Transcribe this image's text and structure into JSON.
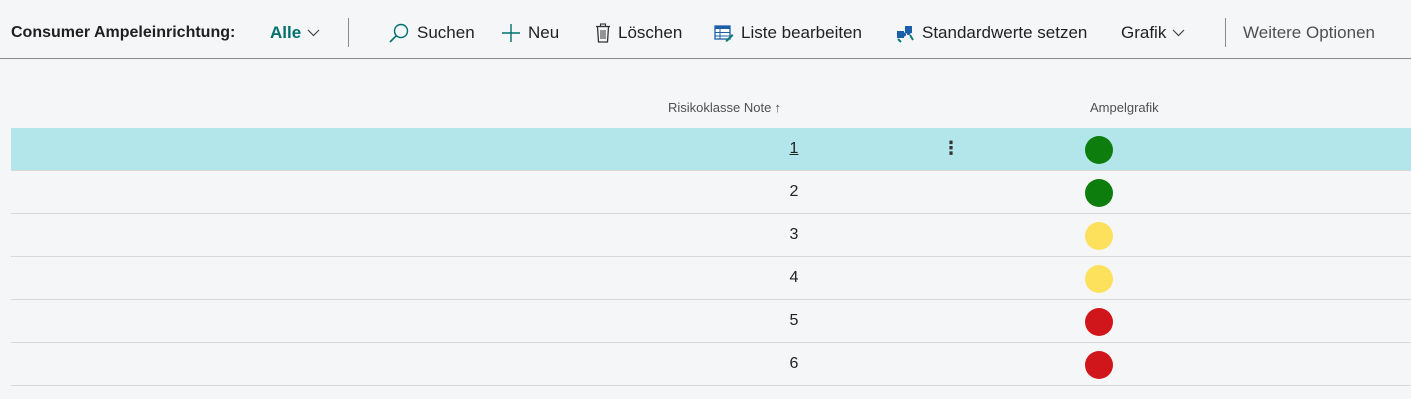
{
  "header": {
    "title": "Consumer Ampeleinrichtung:",
    "filter_label": "Alle"
  },
  "toolbar": {
    "search_label": "Suchen",
    "new_label": "Neu",
    "delete_label": "Löschen",
    "edit_list_label": "Liste bearbeiten",
    "set_defaults_label": "Standardwerte setzen",
    "grafik_label": "Grafik",
    "more_options_label": "Weitere Optionen"
  },
  "table": {
    "columns": [
      "Risikoklasse Note",
      "Ampelgrafik"
    ],
    "sort_indicator": "↑",
    "rows": [
      {
        "note": "1",
        "color": "#0d7d0d",
        "selected": true
      },
      {
        "note": "2",
        "color": "#0d7d0d",
        "selected": false
      },
      {
        "note": "3",
        "color": "#fde05c",
        "selected": false
      },
      {
        "note": "4",
        "color": "#fde05c",
        "selected": false
      },
      {
        "note": "5",
        "color": "#d0161a",
        "selected": false
      },
      {
        "note": "6",
        "color": "#d0161a",
        "selected": false
      }
    ]
  },
  "colors": {
    "accent": "#00706e",
    "selected_row": "#b2e6ea"
  },
  "icons": {
    "row_menu": "⋮"
  }
}
